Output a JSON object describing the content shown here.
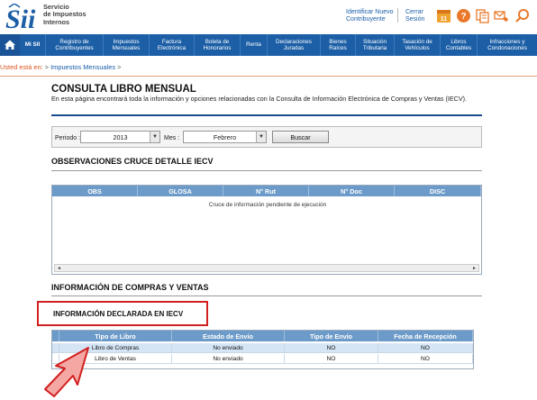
{
  "header": {
    "logo_text": [
      "Servicio",
      "de Impuestos",
      "Internos"
    ],
    "links": {
      "identificar": [
        "Identificar Nuevo",
        "Contribuyente"
      ],
      "cerrar": [
        "Cerrar",
        "Sesión"
      ]
    },
    "calendar_day": "11",
    "icons": [
      "calendar-icon",
      "help-icon",
      "documents-icon",
      "mail-phone-icon",
      "search-icon"
    ]
  },
  "nav": {
    "home_icon": "home-icon",
    "items": [
      {
        "label": [
          "Mi SII"
        ]
      },
      {
        "label": [
          "Registro de",
          "Contribuyentes"
        ]
      },
      {
        "label": [
          "Impuestos",
          "Mensuales"
        ]
      },
      {
        "label": [
          "Factura",
          "Electrónica"
        ]
      },
      {
        "label": [
          "Boleta de",
          "Honorarios"
        ]
      },
      {
        "label": [
          "Renta"
        ]
      },
      {
        "label": [
          "Declaraciones",
          "Juradas"
        ]
      },
      {
        "label": [
          "Bienes",
          "Raíces"
        ]
      },
      {
        "label": [
          "Situación",
          "Tributaria"
        ]
      },
      {
        "label": [
          "Tasación de",
          "Vehículos"
        ]
      },
      {
        "label": [
          "Libros",
          "Contables"
        ]
      },
      {
        "label": [
          "Infracciones y",
          "Condonaciones"
        ]
      }
    ]
  },
  "breadcrumb": {
    "lead": "Usted está en:",
    "sep": ">",
    "link": "Impuestos Mensuales",
    "trail": ">"
  },
  "page": {
    "title": "CONSULTA LIBRO MENSUAL",
    "description": "En esta página encontrará toda la información y opciones relacionadas con la Consulta de Información Electrónica de Compras y Ventas (IECV)."
  },
  "filter": {
    "periodo_label": "Periodo :",
    "periodo_value": "2013",
    "mes_label": "Mes :",
    "mes_value": "Febrero",
    "buscar": "Buscar"
  },
  "observaciones": {
    "title": "OBSERVACIONES CRUCE DETALLE IECV",
    "columns": [
      "OBS",
      "GLOSA",
      "N° Rut",
      "N° Doc",
      "DISC"
    ],
    "pending_message": "Cruce de información pendiente de ejecución"
  },
  "compras_ventas": {
    "title": "INFORMACIÓN DE COMPRAS Y VENTAS",
    "declarada_title": "INFORMACIÓN DECLARADA EN IECV",
    "columns": [
      "Tipo de Libro",
      "Estado de Envío",
      "Tipo de Envío",
      "Fecha de Recepción"
    ],
    "rows": [
      {
        "tipo": "Libro de Compras",
        "estado": "No enviado",
        "tipo_envio": "NO",
        "fecha": "NO"
      },
      {
        "tipo": "Libro de Ventas",
        "estado": "No enviado",
        "tipo_envio": "NO",
        "fecha": "NO"
      }
    ]
  },
  "colors": {
    "nav_blue": "#1c5fa6",
    "grid_header": "#6d9bc9",
    "highlight_red": "#d21f1f",
    "arrow_fill": "#f4a7a3"
  }
}
